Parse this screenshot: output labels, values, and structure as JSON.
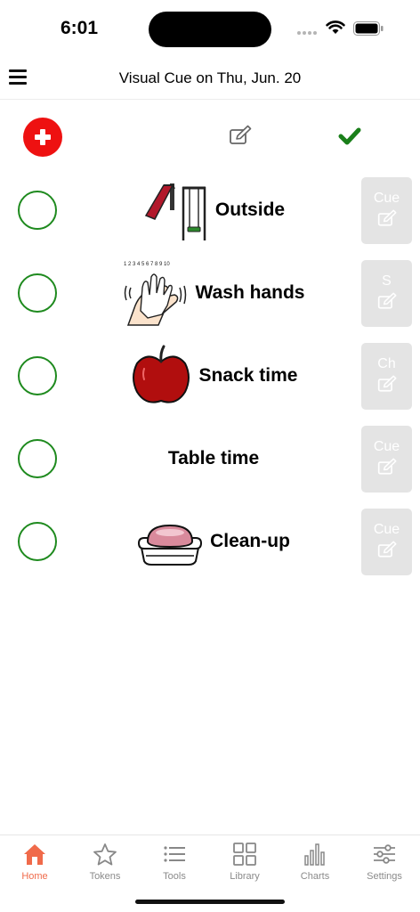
{
  "status": {
    "time": "6:01"
  },
  "header": {
    "title": "Visual Cue on Thu, Jun. 20"
  },
  "actions": {
    "add_icon": "plus-icon",
    "edit_icon": "edit-icon",
    "check_icon": "check-icon"
  },
  "tasks": [
    {
      "label": "Outside",
      "picture": "playground-icon",
      "cue": "Cue"
    },
    {
      "label": "Wash hands",
      "picture": "wash-hands-icon",
      "cue": "S",
      "picture_text": "1 2 3 4 5 6 7 8 9 10"
    },
    {
      "label": "Snack time",
      "picture": "apple-icon",
      "cue": "Ch"
    },
    {
      "label": "Table time",
      "picture": "",
      "cue": "Cue"
    },
    {
      "label": "Clean-up",
      "picture": "soap-icon",
      "cue": "Cue"
    }
  ],
  "tabs": [
    {
      "label": "Home",
      "icon": "home-icon",
      "active": true
    },
    {
      "label": "Tokens",
      "icon": "star-icon"
    },
    {
      "label": "Tools",
      "icon": "list-icon"
    },
    {
      "label": "Library",
      "icon": "grid-icon"
    },
    {
      "label": "Charts",
      "icon": "bar-chart-icon"
    },
    {
      "label": "Settings",
      "icon": "sliders-icon"
    }
  ],
  "colors": {
    "accent": "#f06a4a",
    "add_red": "#ee1111",
    "check_green": "#1e8a1e",
    "cue_gray": "#e4e4e4"
  }
}
